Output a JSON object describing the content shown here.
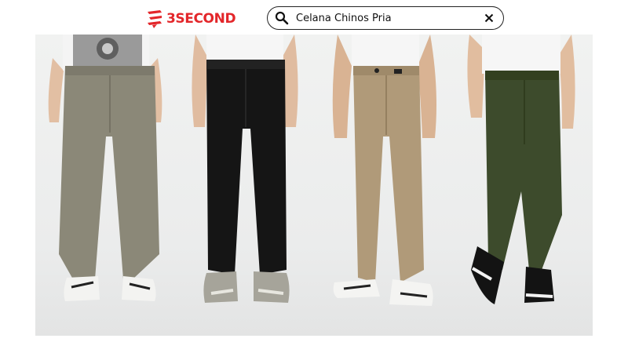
{
  "header": {
    "logo": {
      "text": "3SECOND",
      "color": "#e3262a"
    },
    "search": {
      "value": "Celana Chinos Pria",
      "icon": "search-icon",
      "clear_icon": "close-icon"
    }
  },
  "products": [
    {
      "name": "khaki-grey-chino",
      "color": "#8b8878"
    },
    {
      "name": "black-chino",
      "color": "#151515"
    },
    {
      "name": "sand-chino",
      "color": "#b09a79"
    },
    {
      "name": "olive-chino",
      "color": "#3d4b2c"
    }
  ]
}
